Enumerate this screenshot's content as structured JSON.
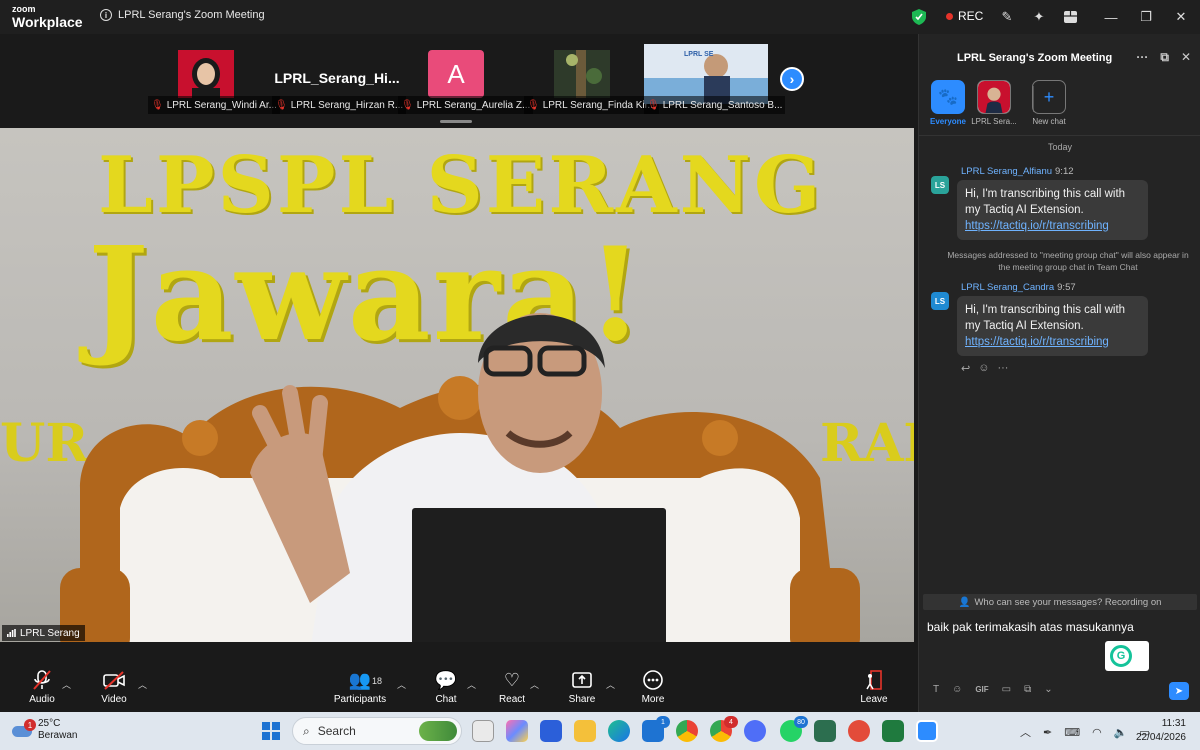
{
  "app": {
    "logo_line1": "zoom",
    "logo_line2": "Workplace",
    "window_title": "LPRL Serang's Zoom Meeting",
    "rec_label": "REC"
  },
  "filmstrip": {
    "tiles": [
      {
        "label": "LPRL Serang_Windi Ar..."
      },
      {
        "label": "LPRL Serang_Hirzan R...",
        "display_name": "LPRL_Serang_Hi..."
      },
      {
        "label": "LPRL Serang_Aurelia Z...",
        "avatar_letter": "A"
      },
      {
        "label": "LPRL Serang_Finda Kir..."
      },
      {
        "label": "LPRL Serang_Santoso B..."
      }
    ]
  },
  "main_video": {
    "label": "LPRL Serang",
    "wall_line1": "LPSPL SERANG",
    "wall_line2": "Jawara!",
    "wall_left": "UR",
    "wall_right": "RAM"
  },
  "toolbar": {
    "audio": "Audio",
    "video": "Video",
    "participants": "Participants",
    "participants_count": "18",
    "chat": "Chat",
    "react": "React",
    "share": "Share",
    "more": "More",
    "leave": "Leave"
  },
  "chat": {
    "title": "LPRL Serang's Zoom Meeting",
    "recipients": {
      "everyone": "Everyone",
      "person": "LPRL Sera...",
      "new_chat": "New chat"
    },
    "today": "Today",
    "messages": [
      {
        "initials": "LS",
        "sender": "LPRL Serang_Alfianu",
        "time": "9:12",
        "text": "Hi, I'm transcribing this call with my Tactiq AI Extension.",
        "link": "https://tactiq.io/r/transcribing"
      },
      {
        "initials": "LS",
        "sender": "LPRL Serang_Candra",
        "time": "9:57",
        "text": "Hi, I'm transcribing this call with my Tactiq AI Extension.",
        "link": "https://tactiq.io/r/transcribing"
      }
    ],
    "system_note": "Messages addressed to \"meeting group chat\" will also appear in the meeting group chat in Team Chat",
    "who_can_see": "Who can see your messages? Recording on",
    "composer_text": "baik pak terimakasih atas masukannya",
    "gif_label": "GIF"
  },
  "taskbar": {
    "temperature": "25°C",
    "weather": "Berawan",
    "weather_badge": "1",
    "search_label": "Search",
    "badge_chrome": "4",
    "badge_whatsapp": "80",
    "badge_store": "1",
    "time": "11:31",
    "date": "22/04/2026"
  },
  "colors": {
    "accent": "#2d8cff",
    "rec": "#e5332a",
    "wall_text": "#e4d81e"
  }
}
